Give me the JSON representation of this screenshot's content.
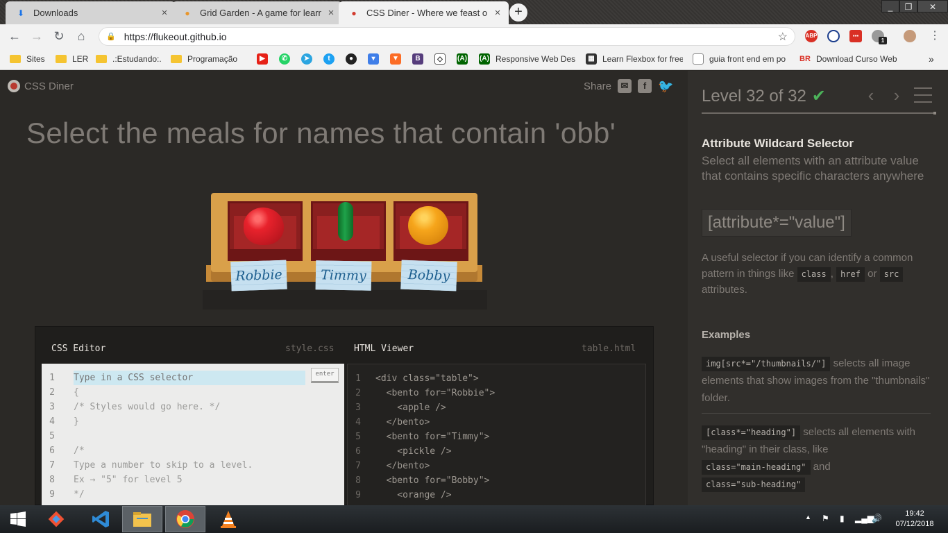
{
  "browser": {
    "tabs": [
      {
        "title": "Downloads",
        "icon": "download-icon"
      },
      {
        "title": "Grid Garden - A game for learnin",
        "icon": "carrot-icon"
      },
      {
        "title": "CSS Diner - Where we feast on C",
        "icon": "css-diner-icon"
      }
    ],
    "new_tab": "+",
    "url": "https://flukeout.github.io",
    "bookmarks": [
      {
        "label": "Sites"
      },
      {
        "label": "LER"
      },
      {
        "label": ".:Estudando:."
      },
      {
        "label": "Programação"
      },
      {
        "label": "Responsive Web Des"
      },
      {
        "label": "Learn Flexbox for free"
      },
      {
        "label": "guia front end em po"
      },
      {
        "label": "Download Curso Web"
      }
    ],
    "more_bookmarks": "»",
    "extension_badge": "1",
    "colors": {
      "tab_active": "#f2f2f2",
      "frame": "#3a3836"
    }
  },
  "site": {
    "brand": "CSS Diner",
    "share_label": "Share",
    "instruction": "Select the meals for names that contain 'obb'"
  },
  "table": {
    "items": [
      {
        "name": "Robbie",
        "food": "apple"
      },
      {
        "name": "Timmy",
        "food": "pickle"
      },
      {
        "name": "Bobby",
        "food": "orange"
      }
    ]
  },
  "css_editor": {
    "title": "CSS Editor",
    "file": "style.css",
    "placeholder": "Type in a CSS selector",
    "enter_label": "enter",
    "lines": [
      "{",
      "/* Styles would go here. */",
      "}",
      "",
      "/*",
      "Type a number to skip to a level.",
      "Ex → \"5\" for level 5",
      "*/"
    ]
  },
  "html_viewer": {
    "title": "HTML Viewer",
    "file": "table.html",
    "lines": [
      "<div class=\"table\">",
      "  <bento for=\"Robbie\">",
      "    <apple />",
      "  </bento>",
      "  <bento for=\"Timmy\">",
      "    <pickle />",
      "  </bento>",
      "  <bento for=\"Bobby\">",
      "    <orange />"
    ]
  },
  "sidebar": {
    "level": "Level 32 of 32",
    "check": "✔",
    "selector_name": "Attribute Wildcard Selector",
    "selector_desc": "Select all elements with an attribute value that contains specific characters anywhere",
    "syntax": "[attribute*=\"value\"]",
    "hint_pre": "A useful selector if you can identify a common pattern in things like",
    "hint_tag1": "class",
    "hint_sep1": ",",
    "hint_tag2": "href",
    "hint_sep2": "or",
    "hint_tag3": "src",
    "hint_post": "attributes.",
    "examples_title": "Examples",
    "example1_code": "img[src*=\"/thumbnails/\"]",
    "example1_text": "selects all image elements that show images from the \"thumbnails\" folder.",
    "example2_code": "[class*=\"heading\"]",
    "example2_text_a": "selects all elements with \"heading\" in their class, like",
    "example2_code_b": "class=\"main-heading\"",
    "example2_text_c": "and",
    "example2_code_d": "class=\"sub-heading\"",
    "accent_color": "#4cb35a"
  },
  "taskbar": {
    "time": "19:42",
    "date": "07/12/2018"
  }
}
